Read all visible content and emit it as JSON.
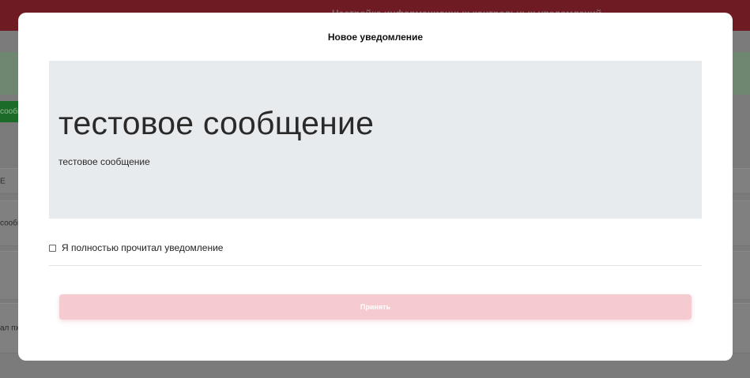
{
  "background": {
    "topbar_title": "Настройка информационных контрольных уведомлений",
    "side_button_label": "сообщ",
    "rows": [
      "E",
      "сообщ",
      "",
      "ал пж"
    ]
  },
  "modal": {
    "title": "Новое уведомление",
    "message": {
      "heading": "тестовое сообщение",
      "body": "тестовое сообщение"
    },
    "acknowledge": {
      "label": "Я полностью прочитал уведомление",
      "checked": false
    },
    "accept_button": {
      "label": "Принять",
      "enabled": false
    }
  },
  "colors": {
    "overlay": "#7b7b7b",
    "accent_disabled": "#f6cbd0",
    "message_bg": "#e8ebee",
    "topbar": "#6e1b24"
  }
}
